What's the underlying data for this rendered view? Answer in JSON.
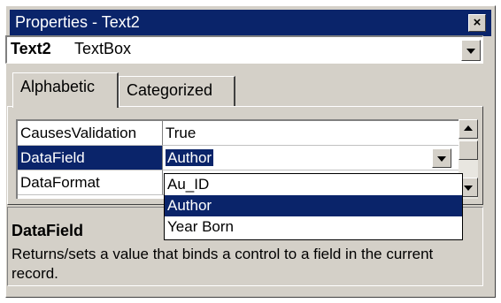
{
  "window": {
    "title": "Properties - Text2",
    "close_symbol": "×"
  },
  "object_selector": {
    "name": "Text2",
    "type": "TextBox"
  },
  "tabs": [
    {
      "label": "Alphabetic",
      "active": true
    },
    {
      "label": "Categorized",
      "active": false
    }
  ],
  "properties": [
    {
      "name": "CausesValidation",
      "value": "True"
    },
    {
      "name": "DataField",
      "value": "Author",
      "selected": true
    },
    {
      "name": "DataFormat",
      "value": ""
    }
  ],
  "datafield_dropdown": {
    "options": [
      "Au_ID",
      "Author",
      "Year Born"
    ],
    "highlighted": "Author"
  },
  "description": {
    "title": "DataField",
    "text": "Returns/sets a value that binds a control to a field in the current record."
  },
  "colors": {
    "selection": "#0a246a",
    "face": "#d4d0c8"
  }
}
